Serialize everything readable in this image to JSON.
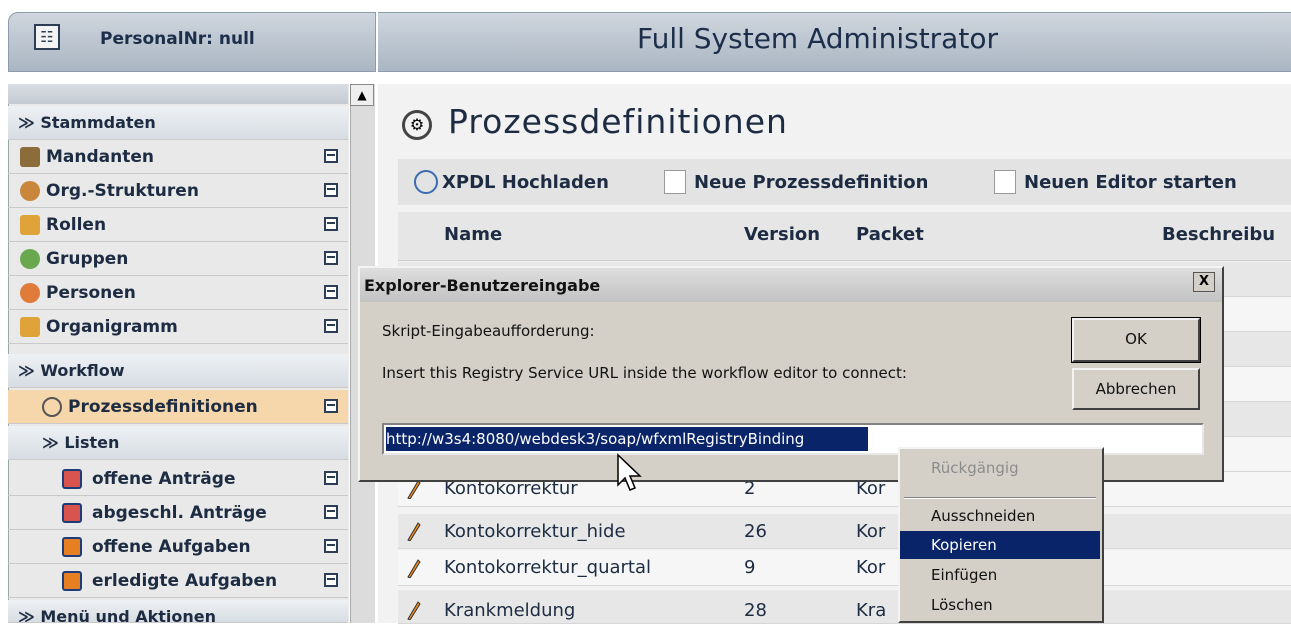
{
  "header": {
    "personal_label": "PersonalNr: null",
    "title": "Full System Administrator"
  },
  "sidebar": {
    "sections": [
      {
        "label": "Stammdaten"
      },
      {
        "label": "Workflow"
      },
      {
        "label": "Listen"
      },
      {
        "label": "Menü und Aktionen"
      }
    ],
    "items": [
      {
        "label": "Mandanten"
      },
      {
        "label": "Org.-Strukturen"
      },
      {
        "label": "Rollen"
      },
      {
        "label": "Gruppen"
      },
      {
        "label": "Personen"
      },
      {
        "label": "Organigramm"
      },
      {
        "label": "Prozessdefinitionen"
      },
      {
        "label": "offene Anträge"
      },
      {
        "label": "abgeschl. Anträge"
      },
      {
        "label": "offene Aufgaben"
      },
      {
        "label": "erledigte Aufgaben"
      }
    ]
  },
  "main": {
    "title": "Prozessdefinitionen",
    "toolbar": {
      "upload": "XPDL Hochladen",
      "new_def": "Neue Prozessdefinition",
      "new_editor": "Neuen Editor starten"
    },
    "columns": [
      "Name",
      "Version",
      "Packet",
      "Beschreibu"
    ],
    "rows": [
      {
        "name": "Kontokorrektur",
        "version": "2",
        "packet": "Kor"
      },
      {
        "name": "Kontokorrektur_hide",
        "version": "26",
        "packet": "Kor"
      },
      {
        "name": "Kontokorrektur_quartal",
        "version": "9",
        "packet": "Kor"
      },
      {
        "name": "Krankmeldung",
        "version": "28",
        "packet": "Kra"
      }
    ]
  },
  "dialog": {
    "title": "Explorer-Benutzereingabe",
    "close": "X",
    "prompt_label": "Skript-Eingabeaufforderung:",
    "message": "Insert this Registry Service URL inside the workflow editor to connect:",
    "ok": "OK",
    "cancel": "Abbrechen",
    "url_value": "http://w3s4:8080/webdesk3/soap/wfxmlRegistryBinding"
  },
  "context_menu": {
    "items": [
      {
        "label": "Rückgängig",
        "state": "disabled"
      },
      {
        "label": "Ausschneiden",
        "state": "normal"
      },
      {
        "label": "Kopieren",
        "state": "highlighted"
      },
      {
        "label": "Einfügen",
        "state": "normal"
      },
      {
        "label": "Löschen",
        "state": "normal"
      }
    ]
  },
  "colors": {
    "selection": "#0a246a",
    "dialog_bg": "#d4d0c8",
    "active_nav": "#f6d7ab",
    "text_dark": "#1d2c42"
  }
}
